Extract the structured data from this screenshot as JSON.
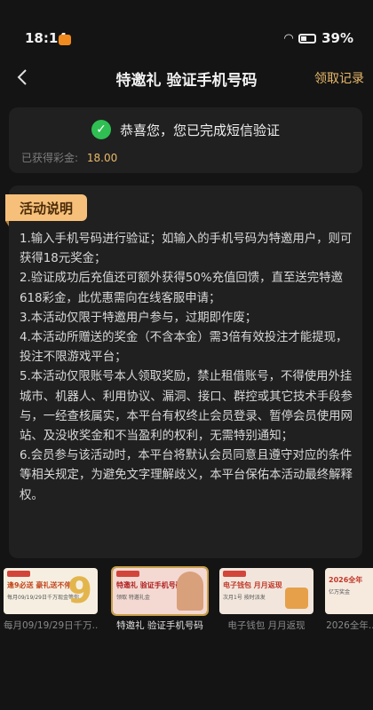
{
  "status": {
    "time": "18:14",
    "battery": "39%"
  },
  "nav": {
    "title": "特邀礼 验证手机号码",
    "record": "领取记录"
  },
  "success": {
    "message": "恭喜您，您已完成短信验证",
    "bonus_label": "已获得彩金:",
    "bonus_value": "18.00"
  },
  "rules": {
    "tag": "活动说明",
    "items": [
      "1.输入手机号码进行验证；如输入的手机号码为特邀用户，则可获得18元奖金；",
      "2.验证成功后充值还可额外获得50%充值回馈，直至送完特邀618彩金，此优惠需向在线客服申请；",
      "3.本活动仅限于特邀用户参与，过期即作废；",
      "4.本活动所赠送的奖金（不含本金）需3倍有效投注才能提现，投注不限游戏平台；",
      "5.本活动仅限账号本人领取奖励，禁止租借账号，不得使用外挂城市、机器人、利用协议、漏洞、接口、群控或其它技术手段参与，一经查核属实，本平台有权终止会员登录、暂停会员使用网站、及没收奖金和不当盈利的权利，无需特别通知；",
      "6.会员参与该活动时，本平台将默认会员同意且遵守对应的条件等相关规定，为避免文字理解歧义，本平台保佑本活动最终解释权。"
    ]
  },
  "carousel": [
    {
      "caption": "每月09/19/29日千万...",
      "thumb_text": "逢9必送 豪礼送不停",
      "thumb_sub": "每月09/19/29日千万现金等你",
      "thumb_num": "9",
      "bg": "#f6efe1",
      "fg": "#c2461e"
    },
    {
      "caption": "特邀礼 验证手机号码",
      "thumb_text": "特邀礼 验证手机号码",
      "thumb_sub": "领取 特邀礼金",
      "bg": "#f3d9d2",
      "fg": "#b02020"
    },
    {
      "caption": "电子钱包 月月返现",
      "thumb_text": "电子钱包 月月返现",
      "thumb_sub": "次月1号 按时派发",
      "bg": "#f2e6dc",
      "fg": "#c0392b"
    },
    {
      "caption": "2026全年...",
      "thumb_text": "2026全年",
      "thumb_sub": "亿万奖金",
      "bg": "#f6eadf",
      "fg": "#c0392b"
    }
  ],
  "colors": {
    "accent": "#e9b96a",
    "success": "#2fbf53",
    "tag_bg": "#f6c07a",
    "card_bg": "#202020"
  },
  "icons": {
    "back": "chevron-left-icon",
    "check": "check-circle-icon",
    "wifi": "wifi-icon",
    "battery": "battery-icon"
  }
}
